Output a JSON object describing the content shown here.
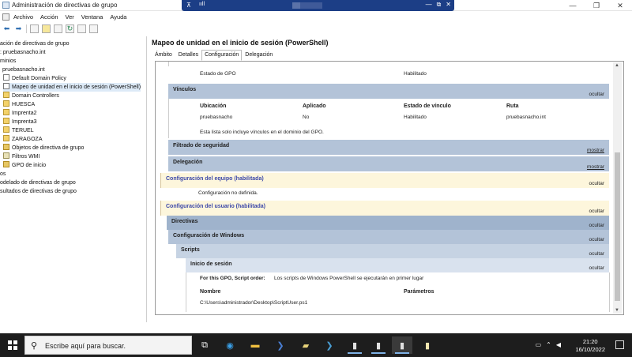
{
  "window": {
    "title": "Administración de directivas de grupo",
    "controls": [
      "—",
      "❐",
      "✕"
    ]
  },
  "rdp": {
    "pin": "⊼",
    "signal": "ııll",
    "controls": [
      "—",
      "⧉",
      "✕"
    ]
  },
  "menu": [
    "Archivo",
    "Acción",
    "Ver",
    "Ventana",
    "Ayuda"
  ],
  "tree": [
    {
      "label": "ación de directivas de grupo",
      "icon": "gpm-icon"
    },
    {
      "label": ": pruebasnacho.int",
      "icon": ""
    },
    {
      "label": "minios",
      "icon": ""
    },
    {
      "label": "pruebasnacho.int",
      "icon": ""
    },
    {
      "label": "Default Domain Policy",
      "icon": "gpo-link-icon"
    },
    {
      "label": "Mapeo de unidad en el inicio de sesión (PowerShell)",
      "icon": "gpo-link-icon"
    },
    {
      "label": "Domain Controllers",
      "icon": "ou-icon"
    },
    {
      "label": "HUESCA",
      "icon": "ou-icon"
    },
    {
      "label": "Imprenta2",
      "icon": "ou-icon"
    },
    {
      "label": "Imprenta3",
      "icon": "ou-icon"
    },
    {
      "label": "TERUEL",
      "icon": "ou-icon"
    },
    {
      "label": "ZARAGOZA",
      "icon": "ou-icon"
    },
    {
      "label": "Objetos de directiva de grupo",
      "icon": "folder-icon"
    },
    {
      "label": "Filtros WMI",
      "icon": "folder-icon"
    },
    {
      "label": "GPO de inicio",
      "icon": "folder-icon"
    },
    {
      "label": "os",
      "icon": ""
    },
    {
      "label": "odelado de directivas de grupo",
      "icon": ""
    },
    {
      "label": "sultados de directivas de grupo",
      "icon": ""
    }
  ],
  "panel": {
    "title": "Mapeo de unidad en el inicio de sesión (PowerShell)",
    "tabs": [
      "Ámbito",
      "Detalles",
      "Configuración",
      "Delegación"
    ],
    "active_tab": "Configuración"
  },
  "report": {
    "estado_label": "Estado de GPO",
    "estado_value": "Habilitado",
    "vinculos": {
      "title": "Vínculos",
      "action": "ocultar",
      "headers": [
        "Ubicación",
        "Aplicado",
        "Estado de vínculo",
        "Ruta"
      ],
      "row": [
        "pruebasnacho",
        "No",
        "Habilitado",
        "pruebasnacho.int"
      ],
      "note": "Esta lista solo incluye vínculos en el dominio del GPO."
    },
    "filtrado": {
      "title": "Filtrado de seguridad",
      "action": "mostrar"
    },
    "delegacion": {
      "title": "Delegación",
      "action": "mostrar"
    },
    "equipo": {
      "title": "Configuración del equipo (habilitada)",
      "action": "ocultar",
      "note": "Configuración no definida."
    },
    "usuario": {
      "title": "Configuración del usuario (habilitada)",
      "action": "ocultar"
    },
    "directivas": {
      "title": "Directivas",
      "action": "ocultar"
    },
    "windows": {
      "title": "Configuración de Windows",
      "action": "ocultar"
    },
    "scripts": {
      "title": "Scripts",
      "action": "ocultar"
    },
    "inicio": {
      "title": "Inicio de sesión",
      "action": "ocultar"
    },
    "script_order_label": "For this GPO, Script order:",
    "script_order_value": "Los scripts de Windows PowerShell se ejecutarán en primer lugar",
    "script_headers": [
      "Nombre",
      "Parámetros"
    ],
    "script_row": [
      "C:\\Users\\administrador\\Desktop\\ScriptUser.ps1",
      ""
    ]
  },
  "taskbar": {
    "search_placeholder": "Escribe aquí para buscar.",
    "time": "21:20",
    "date": "16/10/2022"
  }
}
